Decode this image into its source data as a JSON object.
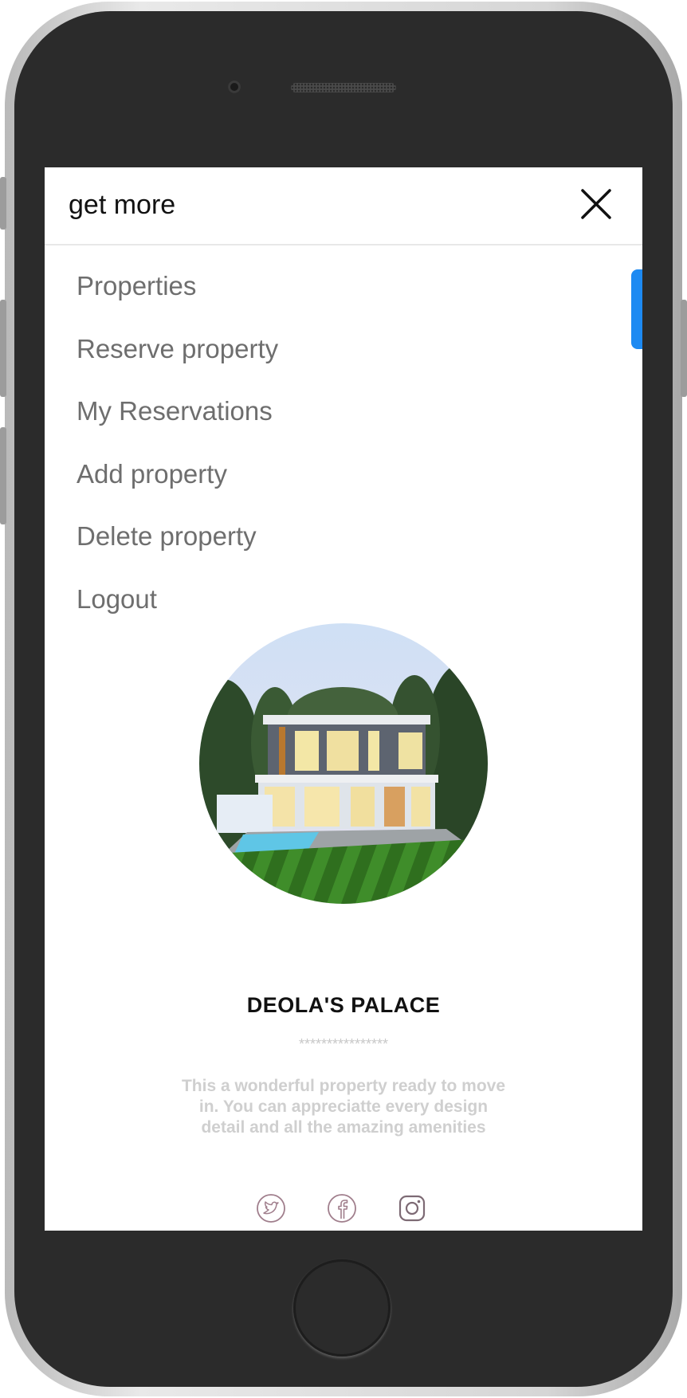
{
  "header": {
    "brand": "get more"
  },
  "menu": {
    "items": [
      {
        "label": "Properties"
      },
      {
        "label": "Reserve property"
      },
      {
        "label": "My Reservations"
      },
      {
        "label": "Add property"
      },
      {
        "label": "Delete property"
      },
      {
        "label": "Logout"
      }
    ]
  },
  "property": {
    "name": "DEOLA'S PALACE",
    "stars": "****************",
    "description": "This a wonderful property ready to move in. You can appreciatte every design detail and all the amazing amenities"
  },
  "social": {
    "icons": [
      "twitter-icon",
      "facebook-icon",
      "instagram-icon"
    ]
  },
  "colors": {
    "accent": "#1d8af2",
    "menu_text": "#6e6e6e",
    "muted_text": "#cfcfcf",
    "phone_body": "#2b2b2b"
  }
}
